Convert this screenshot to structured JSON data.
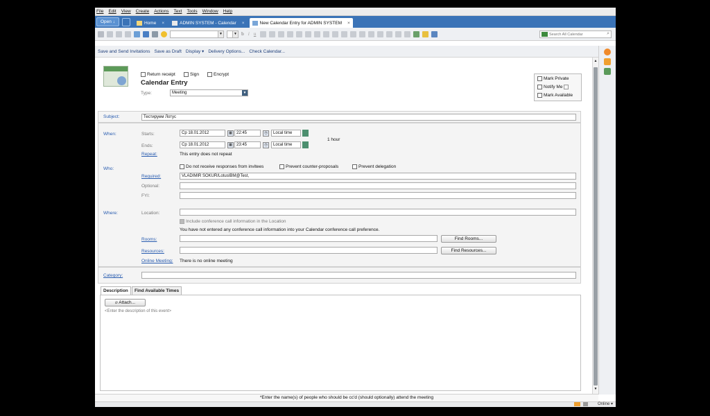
{
  "menu": [
    "File",
    "Edit",
    "View",
    "Create",
    "Actions",
    "Text",
    "Tools",
    "Window",
    "Help"
  ],
  "tabs": {
    "open_label": "Open ↓",
    "items": [
      {
        "label": "Home"
      },
      {
        "label": "ADMIN SYSTEM - Calendar"
      },
      {
        "label": "New Calendar Entry for ADMIN SYSTEM"
      }
    ],
    "close_glyph": "×"
  },
  "toolbar": {
    "format_glyphs": [
      "b",
      "i",
      "u"
    ],
    "search_placeholder": "Search All Calendar"
  },
  "actions": [
    "Save and Send Invitations",
    "Save as Draft",
    "Display ▾",
    "Delivery Options...",
    "Check Calendar..."
  ],
  "header": {
    "title": "Calendar Entry",
    "type_label": "Type:",
    "type_value": "Meeting",
    "checkboxes": [
      "Return receipt",
      "Sign",
      "Encrypt"
    ],
    "side_checkboxes": [
      "Mark Private",
      "Notify Me",
      "Mark Available"
    ]
  },
  "subject": {
    "label": "Subject:",
    "value": "Тестируем Лотус"
  },
  "when": {
    "label": "When:",
    "starts_label": "Starts:",
    "ends_label": "Ends:",
    "start_date": "Ср 18.01.2012",
    "start_time": "22:45",
    "end_date": "Ср 18.01.2012",
    "end_time": "23:45",
    "timezone": "Local time",
    "duration": "1 hour",
    "repeat_label": "Repeat:",
    "repeat_text": "This entry does not repeat"
  },
  "who": {
    "label": "Who:",
    "options": [
      "Do not receive responses from invitees",
      "Prevent counter-proposals",
      "Prevent delegation"
    ],
    "required_label": "Required:",
    "required_value": "VLADIMIR SOKUR/LotusIBM@Test,",
    "optional_label": "Optional:",
    "fyi_label": "FYI:"
  },
  "where": {
    "label": "Where:",
    "location_label": "Location:",
    "conference_check": "Include conference call information in the Location",
    "conference_note": "You have not entered any conference call information into your Calendar conference call preference.",
    "rooms_label": "Rooms:",
    "find_rooms": "Find Rooms...",
    "resources_label": "Resources:",
    "find_resources": "Find Resources...",
    "online_label": "Online Meeting:",
    "online_text": "There is no online meeting"
  },
  "category": {
    "label": "Category:"
  },
  "bottom_tabs": [
    "Description",
    "Find Available Times"
  ],
  "description": {
    "attach": "Attach...",
    "placeholder": "<Enter the description of this event>"
  },
  "hint": "*Enter the name(s) of people who should be cc'd (should optionally) attend the meeting",
  "status": {
    "online": "Online ▾"
  },
  "colors": {
    "tab_bar": "#3a73b7",
    "link": "#2a5db0",
    "accent_orange": "#f0a030"
  }
}
